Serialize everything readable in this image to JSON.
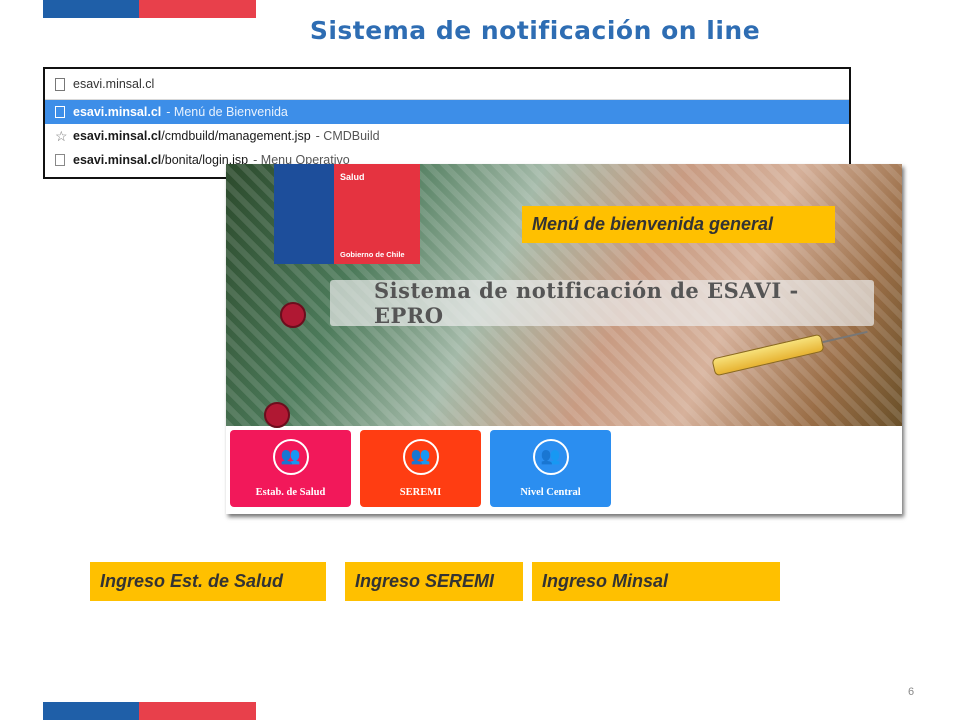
{
  "slide": {
    "title": "Sistema de notificación on line",
    "page_number": "6"
  },
  "browser": {
    "address_value": "esavi.minsal.cl",
    "suggestions": [
      {
        "domain": "esavi.minsal.cl",
        "path": "",
        "description": "- Menú de Bienvenida",
        "icon": "page-icon",
        "selected": true
      },
      {
        "domain": "esavi.minsal.cl",
        "path": "/cmdbuild/management.jsp",
        "description": "- CMDBuild",
        "icon": "star-icon",
        "selected": false
      },
      {
        "domain": "esavi.minsal.cl",
        "path": "/bonita/login.jsp",
        "description": "- Menu Operativo",
        "icon": "page-icon",
        "selected": false
      }
    ]
  },
  "app": {
    "logo_top": "Salud",
    "logo_bottom": "Gobierno de Chile",
    "banner": "Sistema de notificación de ESAVI - EPRO",
    "tiles": [
      {
        "label": "Estab. de Salud",
        "color": "#f2185a",
        "icon": "users-icon"
      },
      {
        "label": "SEREMI",
        "color": "#ff3d12",
        "icon": "users-icon"
      },
      {
        "label": "Nivel Central",
        "color": "#2b8ef0",
        "icon": "users-icon"
      }
    ]
  },
  "callouts": {
    "menu": "Menú de bienvenida general",
    "ingreso_salud": "Ingreso Est. de Salud",
    "ingreso_seremi": "Ingreso SEREMI",
    "ingreso_minsal": "Ingreso Minsal"
  },
  "colors": {
    "title": "#2e6db3",
    "callout_bg": "#ffc000",
    "flag_blue": "#1f5fa8",
    "flag_red": "#e8404b",
    "selected_row": "#3d8ee8"
  }
}
